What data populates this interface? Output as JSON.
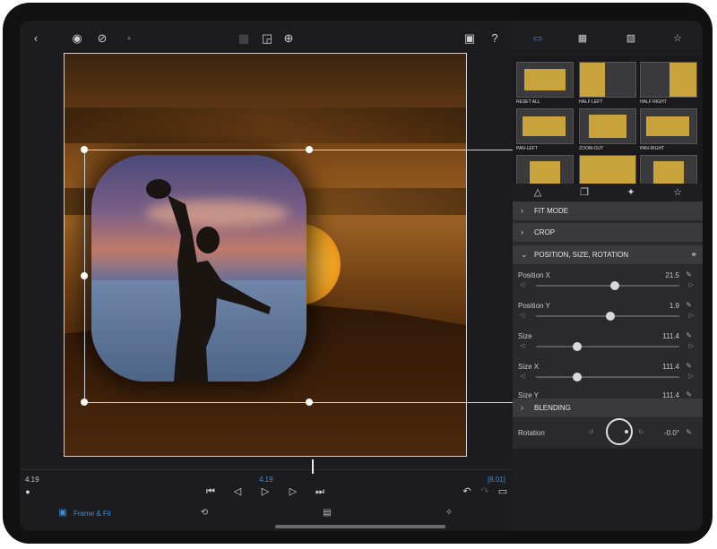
{
  "toolbar": {
    "back_icon": "chevron-left-icon",
    "icons": [
      "eye-icon",
      "eye-slash-icon",
      "crop-icon",
      "zoom-icon",
      "snapshot-icon",
      "help-icon"
    ]
  },
  "timeline": {
    "current_time_left": "4.19",
    "current_time_mid": "4.19",
    "duration": "[8.01]",
    "frame_fit_label": "Frame & Fit"
  },
  "panel": {
    "presets": [
      {
        "label": "RESET ALL"
      },
      {
        "label": "HALF LEFT"
      },
      {
        "label": "HALF RIGHT"
      },
      {
        "label": "PAN-LEFT"
      },
      {
        "label": "ZOOM-OUT"
      },
      {
        "label": "PAN-RIGHT"
      }
    ],
    "sections": {
      "fit_mode": "FIT MODE",
      "crop": "CROP",
      "position": "POSITION, SIZE, ROTATION",
      "blending": "BLENDING"
    },
    "params": [
      {
        "name": "Position X",
        "value": "21.5",
        "level": 0.55
      },
      {
        "name": "Position Y",
        "value": "1.9",
        "level": 0.52
      },
      {
        "name": "Size",
        "value": "111.4",
        "level": 0.29
      },
      {
        "name": "Size X",
        "value": "111.4",
        "level": 0.29
      },
      {
        "name": "Size Y",
        "value": "111.4",
        "level": 0.29
      }
    ],
    "rotation": {
      "name": "Rotation",
      "value": "-0.0°"
    }
  },
  "colors": {
    "accent": "#3c8fe0",
    "preset_fill": "#c9a33b",
    "panel_bg": "#2a2a2c"
  }
}
